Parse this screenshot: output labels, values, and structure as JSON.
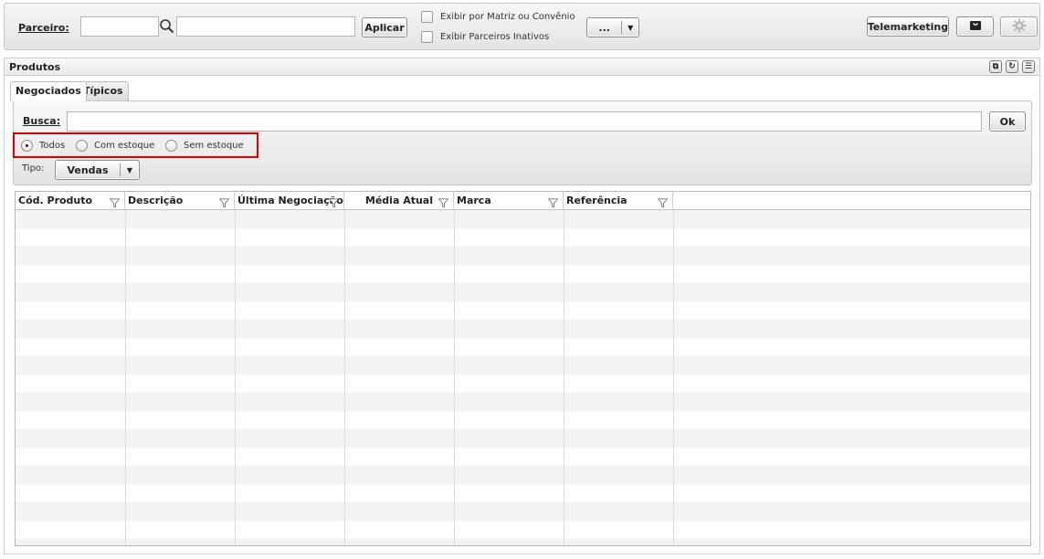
{
  "toolbar": {
    "parceiro_label": "Parceiro:",
    "parceiro_code_value": "",
    "parceiro_name_value": "",
    "aplicar_label": "Aplicar",
    "check_matriz_label": "Exibir por Matriz ou Convênio",
    "check_inativos_label": "Exibir Parceiros Inativos",
    "more_label": "...",
    "telemarketing_label": "Telemarketing"
  },
  "panel": {
    "title": "Produtos",
    "tabs": [
      {
        "label": "Negociados",
        "active": true
      },
      {
        "label": "Típicos",
        "active": false
      }
    ]
  },
  "filters": {
    "busca_label": "Busca:",
    "busca_value": "",
    "ok_label": "Ok",
    "stock_options": [
      {
        "label": "Todos",
        "selected": true
      },
      {
        "label": "Com estoque",
        "selected": false
      },
      {
        "label": "Sem estoque",
        "selected": false
      }
    ],
    "tipo_label": "Tipo:",
    "tipo_value": "Vendas"
  },
  "grid": {
    "columns": [
      {
        "label": "Cód. Produto",
        "align": "left"
      },
      {
        "label": "Descrição",
        "align": "left"
      },
      {
        "label": "Última Negociação",
        "align": "left"
      },
      {
        "label": "Média Atual",
        "align": "right"
      },
      {
        "label": "Marca",
        "align": "left"
      },
      {
        "label": "Referência",
        "align": "left"
      }
    ],
    "rows": []
  }
}
